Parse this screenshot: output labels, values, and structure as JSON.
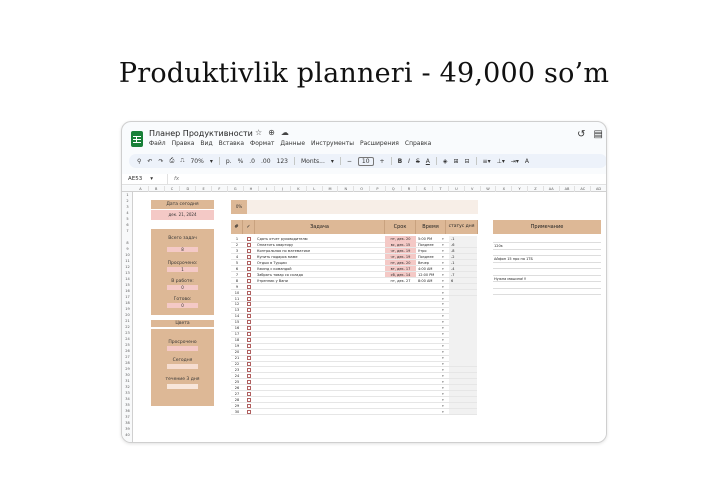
{
  "page_title": "Produktivlik planneri - 49,000 so’m",
  "doc": {
    "title": "Планер Продуктивности",
    "menu": [
      "Файл",
      "Правка",
      "Вид",
      "Вставка",
      "Формат",
      "Данные",
      "Инструменты",
      "Расширения",
      "Справка"
    ]
  },
  "toolbar": {
    "zoom": "70%",
    "currency": "р.",
    "percent": "%",
    "dec_less": ".0",
    "dec_more": ".00",
    "number_format": "123",
    "font": "Monts...",
    "font_size": "10",
    "bold": "B",
    "italic": "I",
    "text_color": "A"
  },
  "formula": {
    "cell_ref": "AE53",
    "fx": "fx"
  },
  "columns": [
    "A",
    "B",
    "C",
    "D",
    "E",
    "F",
    "G",
    "H",
    "I",
    "J",
    "K",
    "L",
    "M",
    "N",
    "O",
    "P",
    "Q",
    "R",
    "S",
    "T",
    "U",
    "V",
    "W",
    "X",
    "Y",
    "Z",
    "AA",
    "AB",
    "AC",
    "AD"
  ],
  "left_panel": {
    "date_label": "Дата сегодня",
    "date_value": "дек. 21, 2024",
    "total_label": "Всего задач",
    "total_value": "8",
    "overdue_label": "Просрочено:",
    "overdue_value": "1",
    "in_progress_label": "В работе:",
    "in_progress_value": "0",
    "done_label": "Готово:",
    "done_value": "0",
    "colors_label": "Цвета",
    "legend_overdue": "Просрочено",
    "legend_today": "Сегодня",
    "legend_3days": "течение 3 дня"
  },
  "progress": "0%",
  "table_headers": {
    "num": "#",
    "check": "✓",
    "task": "Задача",
    "deadline": "Срок",
    "time": "Время",
    "status": "статус дня",
    "notes": "Примечание"
  },
  "tasks": [
    {
      "n": "1",
      "task": "Сдать отчет руководителю",
      "deadline": "пт, дек. 20",
      "time": "5:00 PM",
      "status": "-1",
      "pink": true
    },
    {
      "n": "2",
      "task": "Оплатить квартиру",
      "deadline": "вс, дек. 15",
      "time": "Позднее",
      "status": "-6",
      "pink": true
    },
    {
      "n": "3",
      "task": "Контрольная по математике",
      "deadline": "чт, дек. 19",
      "time": "Утро",
      "status": "-8",
      "pink": true
    },
    {
      "n": "4",
      "task": "Купить подарок маме",
      "deadline": "чт, дек. 19",
      "time": "Позднее",
      "status": "-2",
      "pink": true
    },
    {
      "n": "5",
      "task": "Отдых в Турции",
      "deadline": "пт, дек. 20",
      "time": "Вечер",
      "status": "-1",
      "pink": true
    },
    {
      "n": "6",
      "task": "Ужинд с командой",
      "deadline": "вт, дек. 17",
      "time": "4:00 AM",
      "status": "-4",
      "pink": true
    },
    {
      "n": "7",
      "task": "Забрать товар со склада",
      "deadline": "сб, дек. 14",
      "time": "12:00 PM",
      "status": "-7",
      "pink": true
    },
    {
      "n": "8",
      "task": "Утренник у Вани",
      "deadline": "пт, дек. 27",
      "time": "8:00 AM",
      "status": "6",
      "pink": false
    },
    {
      "n": "9"
    },
    {
      "n": "10"
    },
    {
      "n": "11"
    },
    {
      "n": "12"
    },
    {
      "n": "13"
    },
    {
      "n": "14"
    },
    {
      "n": "15"
    },
    {
      "n": "16"
    },
    {
      "n": "17"
    },
    {
      "n": "18"
    },
    {
      "n": "19"
    },
    {
      "n": "20"
    },
    {
      "n": "21"
    },
    {
      "n": "22"
    },
    {
      "n": "23"
    },
    {
      "n": "24"
    },
    {
      "n": "25"
    },
    {
      "n": "26"
    },
    {
      "n": "27"
    },
    {
      "n": "28"
    },
    {
      "n": "29"
    },
    {
      "n": "30"
    }
  ],
  "notes": [
    "120к",
    "Айфон 15 про на 1ТБ",
    "Нужна машина!!!"
  ],
  "row_numbers": [
    "1",
    "2",
    "3",
    "4",
    "5",
    "6",
    "7",
    "8",
    "9",
    "10",
    "11",
    "12",
    "13",
    "14",
    "15",
    "16",
    "17",
    "18",
    "19",
    "20",
    "21",
    "22",
    "23",
    "24",
    "25",
    "26",
    "27",
    "28",
    "29",
    "30",
    "31",
    "32",
    "33",
    "34",
    "35",
    "36",
    "37",
    "38",
    "39",
    "40"
  ]
}
